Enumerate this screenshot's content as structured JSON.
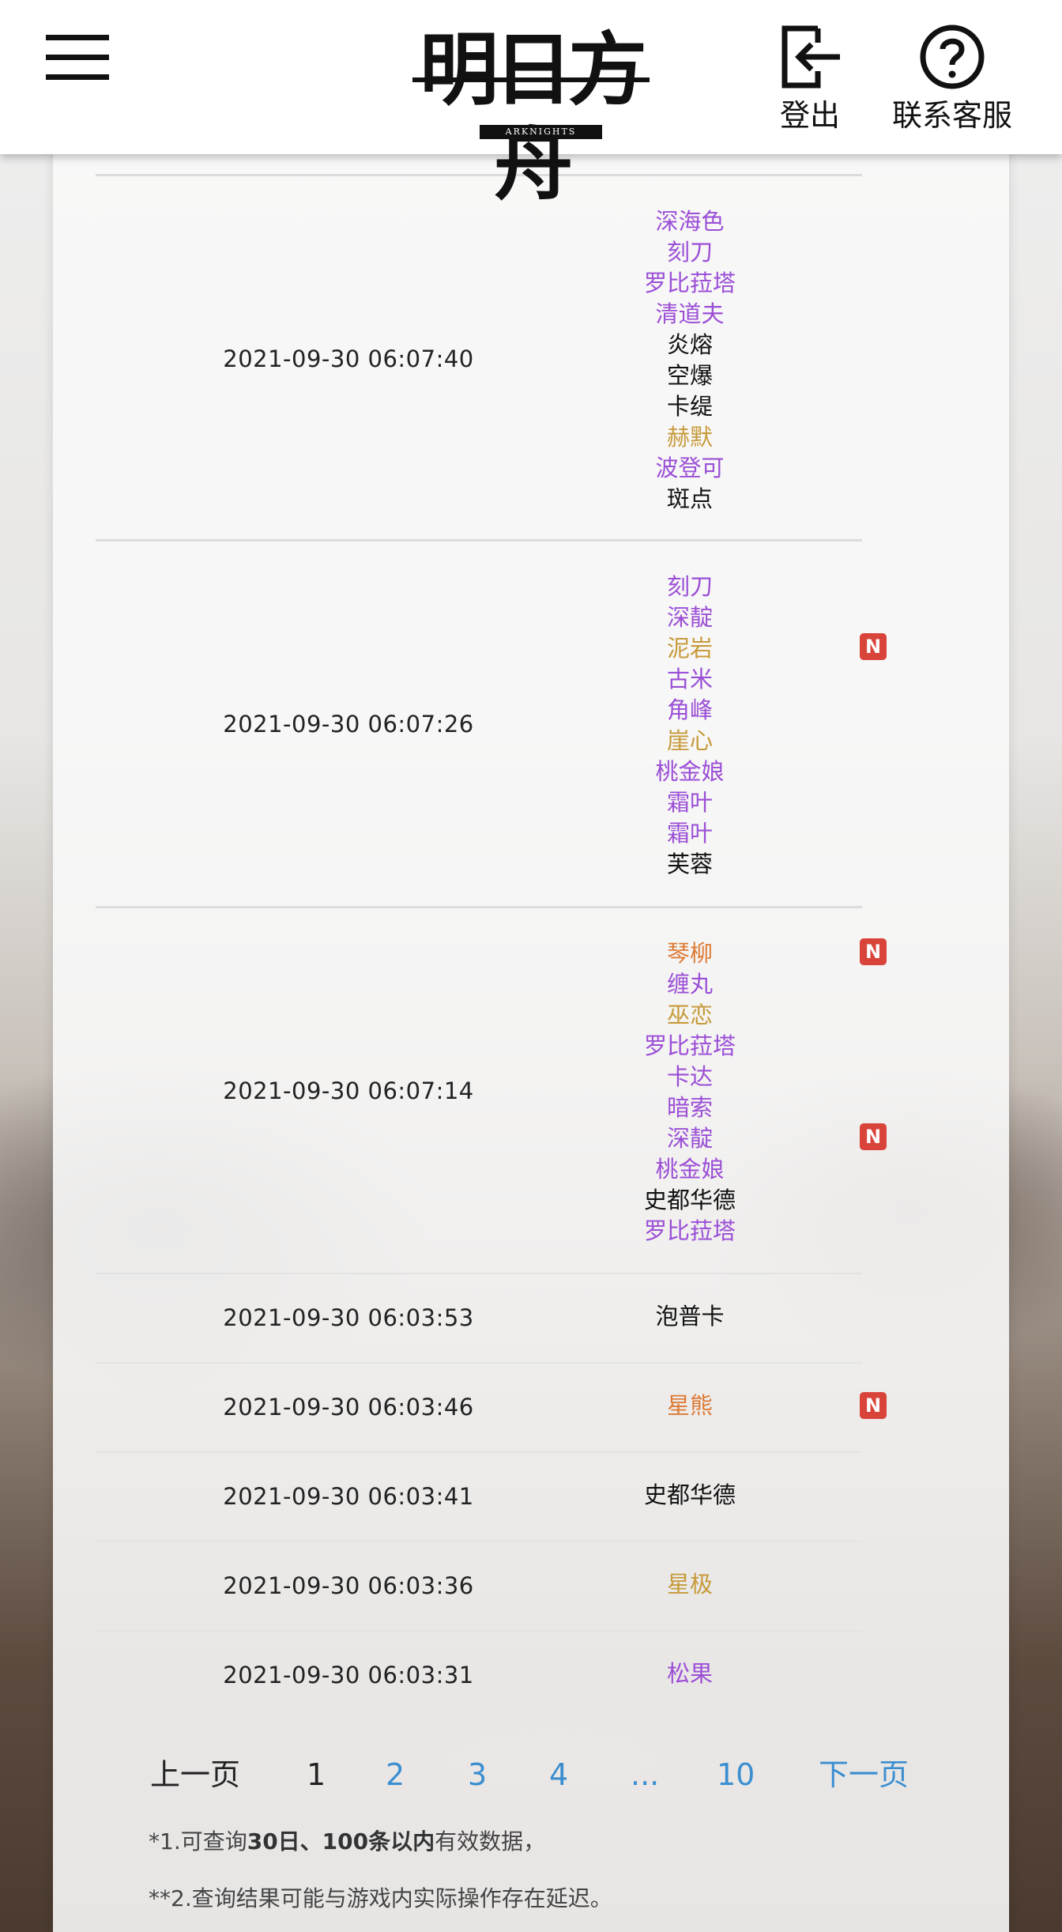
{
  "header": {
    "logo_text": "明日方舟",
    "logo_sub": "ARKNIGHTS",
    "logout_label": "登出",
    "support_label": "联系客服"
  },
  "colors": {
    "purple": "#9b4fd6",
    "gold": "#c79a3a",
    "orange": "#dd7a34",
    "black": "#111111",
    "link_blue": "#3b8ed0",
    "badge_red": "#d9443a"
  },
  "records": [
    {
      "time": "2021-09-30 06:07:40",
      "operators": [
        {
          "name": "深海色",
          "rarity": "purple"
        },
        {
          "name": "刻刀",
          "rarity": "purple"
        },
        {
          "name": "罗比菈塔",
          "rarity": "purple"
        },
        {
          "name": "清道夫",
          "rarity": "purple"
        },
        {
          "name": "炎熔",
          "rarity": "black"
        },
        {
          "name": "空爆",
          "rarity": "black"
        },
        {
          "name": "卡缇",
          "rarity": "black"
        },
        {
          "name": "赫默",
          "rarity": "gold"
        },
        {
          "name": "波登可",
          "rarity": "purple"
        },
        {
          "name": "斑点",
          "rarity": "black"
        }
      ]
    },
    {
      "time": "2021-09-30 06:07:26",
      "operators": [
        {
          "name": "刻刀",
          "rarity": "purple"
        },
        {
          "name": "深靛",
          "rarity": "purple"
        },
        {
          "name": "泥岩",
          "rarity": "gold",
          "new": "N"
        },
        {
          "name": "古米",
          "rarity": "purple"
        },
        {
          "name": "角峰",
          "rarity": "purple"
        },
        {
          "name": "崖心",
          "rarity": "gold"
        },
        {
          "name": "桃金娘",
          "rarity": "purple"
        },
        {
          "name": "霜叶",
          "rarity": "purple"
        },
        {
          "name": "霜叶",
          "rarity": "purple"
        },
        {
          "name": "芙蓉",
          "rarity": "black"
        }
      ]
    },
    {
      "time": "2021-09-30 06:07:14",
      "operators": [
        {
          "name": "琴柳",
          "rarity": "orange",
          "new": "N"
        },
        {
          "name": "缠丸",
          "rarity": "purple"
        },
        {
          "name": "巫恋",
          "rarity": "gold"
        },
        {
          "name": "罗比菈塔",
          "rarity": "purple"
        },
        {
          "name": "卡达",
          "rarity": "purple"
        },
        {
          "name": "暗索",
          "rarity": "purple"
        },
        {
          "name": "深靛",
          "rarity": "purple",
          "new": "N"
        },
        {
          "name": "桃金娘",
          "rarity": "purple"
        },
        {
          "name": "史都华德",
          "rarity": "black"
        },
        {
          "name": "罗比菈塔",
          "rarity": "purple"
        }
      ]
    },
    {
      "time": "2021-09-30 06:03:53",
      "operators": [
        {
          "name": "泡普卡",
          "rarity": "black"
        }
      ]
    },
    {
      "time": "2021-09-30 06:03:46",
      "operators": [
        {
          "name": "星熊",
          "rarity": "orange",
          "new": "N"
        }
      ]
    },
    {
      "time": "2021-09-30 06:03:41",
      "operators": [
        {
          "name": "史都华德",
          "rarity": "black"
        }
      ]
    },
    {
      "time": "2021-09-30 06:03:36",
      "operators": [
        {
          "name": "星极",
          "rarity": "gold"
        }
      ]
    },
    {
      "time": "2021-09-30 06:03:31",
      "operators": [
        {
          "name": "松果",
          "rarity": "purple"
        }
      ]
    }
  ],
  "pagination": {
    "prev": "上一页",
    "current": "1",
    "pages": [
      "2",
      "3",
      "4"
    ],
    "ellipsis": "...",
    "last": "10",
    "next": "下一页"
  },
  "notes": {
    "n1_prefix": "*1.可查询",
    "n1_bold": "30日、100条以内",
    "n1_suffix": "有效数据，",
    "n2": "**2.查询结果可能与游戏内实际操作存在延迟。"
  }
}
